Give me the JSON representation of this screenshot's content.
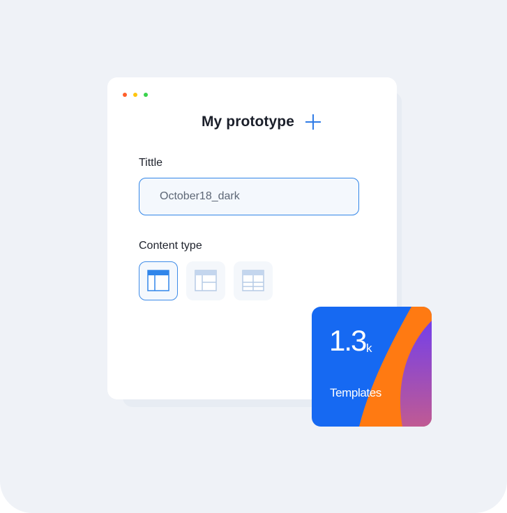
{
  "window": {
    "traffic_lights": [
      "#ff5f2a",
      "#ffc50f",
      "#39d34b"
    ]
  },
  "header": {
    "title": "My prototype",
    "add_icon": "plus-icon"
  },
  "form": {
    "title_label": "Tittle",
    "title_value": "October18_dark",
    "content_type_label": "Content type",
    "content_types": [
      {
        "icon": "layout-header-sidebar-icon",
        "selected": true
      },
      {
        "icon": "layout-header-sidebar-rows-icon",
        "selected": false
      },
      {
        "icon": "layout-grid-icon",
        "selected": false
      }
    ]
  },
  "stats": {
    "value": "1.3",
    "unit": "k",
    "label": "Templates"
  },
  "colors": {
    "accent": "#2f7be6",
    "stat_card_blue": "#1669f2",
    "stat_card_orange": "#ff7a12",
    "stat_card_purple": "#8f45d8"
  }
}
